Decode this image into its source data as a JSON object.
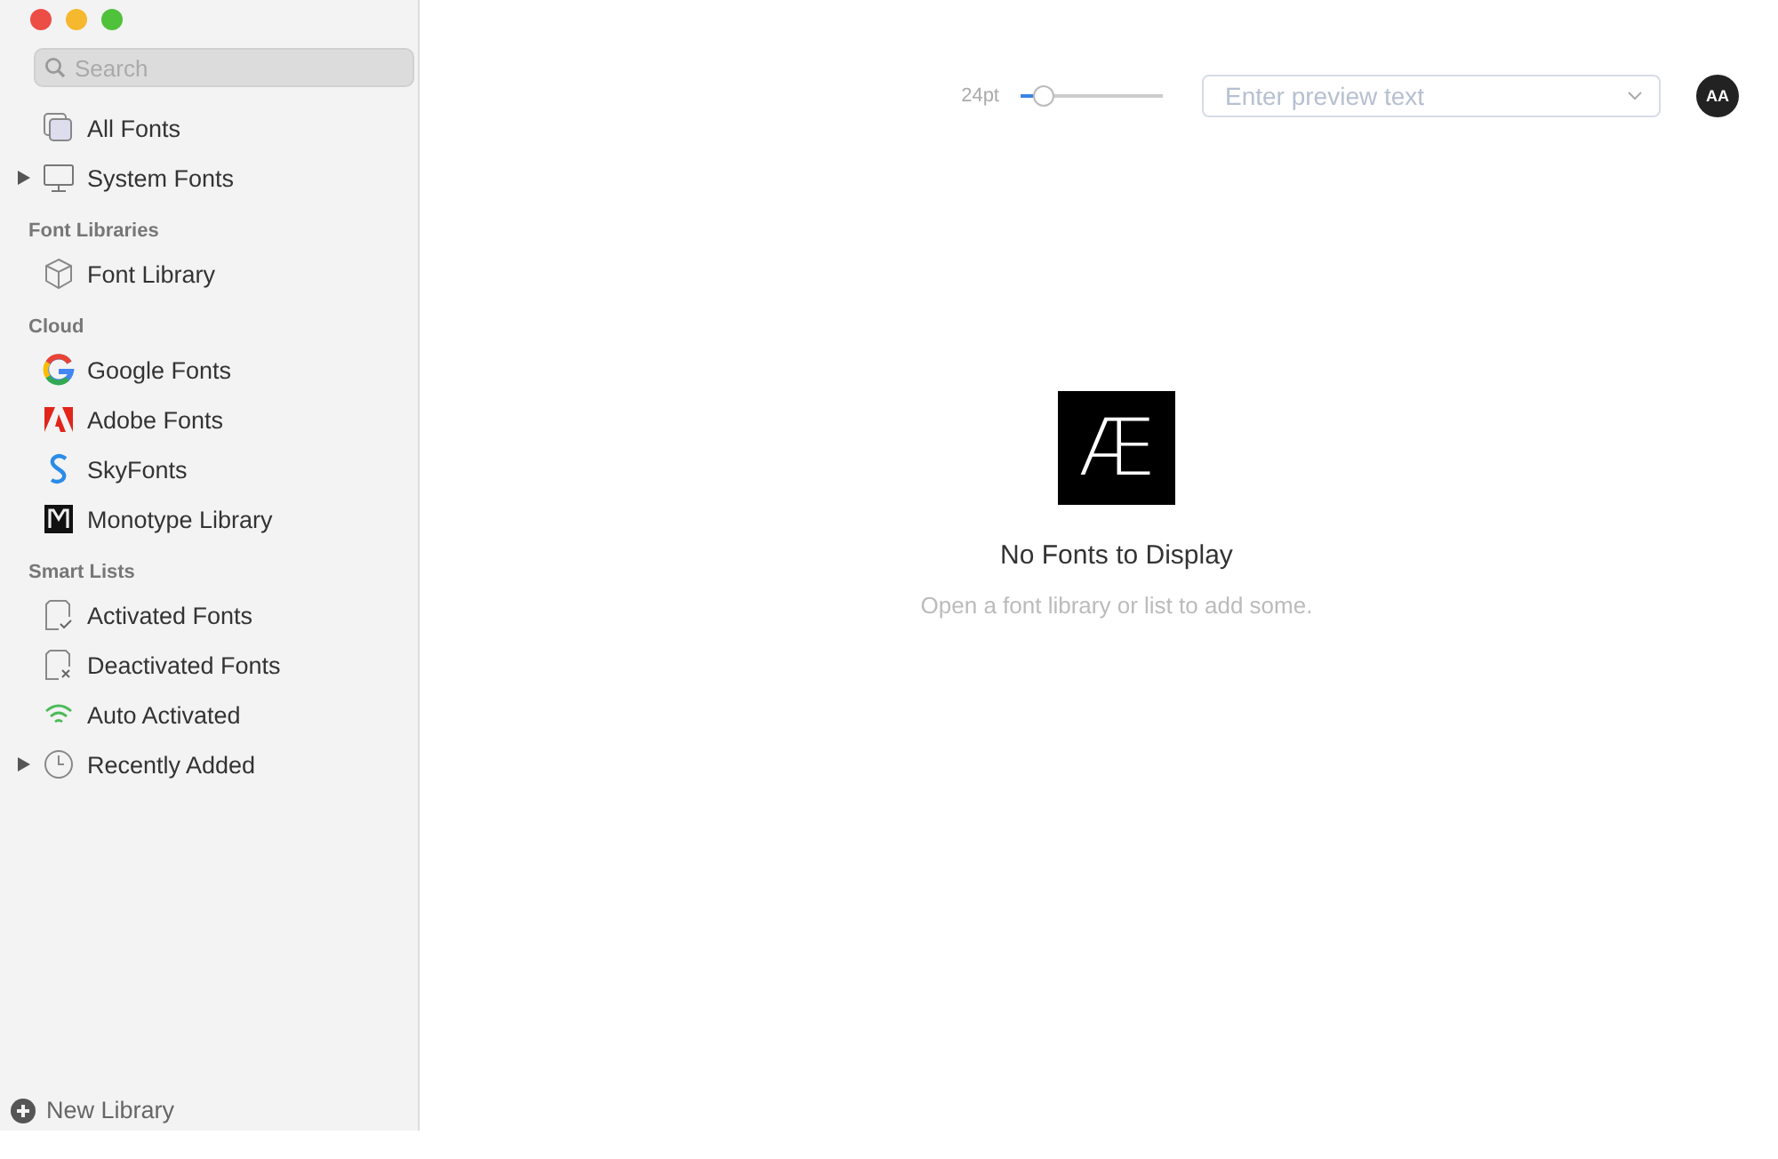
{
  "sidebar": {
    "search": {
      "placeholder": "Search"
    },
    "sections": [
      {
        "items": [
          {
            "label": "All Fonts",
            "kind": "stack"
          },
          {
            "label": "System Fonts",
            "kind": "monitor",
            "expanded": false
          }
        ]
      },
      {
        "title": "Font Libraries",
        "items": [
          {
            "label": "Font Library",
            "kind": "cube"
          }
        ]
      },
      {
        "title": "Cloud",
        "items": [
          {
            "label": "Google Fonts",
            "kind": "google"
          },
          {
            "label": "Adobe Fonts",
            "kind": "adobe"
          },
          {
            "label": "SkyFonts",
            "kind": "sky"
          },
          {
            "label": "Monotype Library",
            "kind": "monotype"
          }
        ]
      },
      {
        "title": "Smart Lists",
        "items": [
          {
            "label": "Activated Fonts",
            "kind": "activated"
          },
          {
            "label": "Deactivated Fonts",
            "kind": "deactivated"
          },
          {
            "label": "Auto Activated",
            "kind": "auto"
          },
          {
            "label": "Recently Added",
            "kind": "recent",
            "expanded": false
          }
        ]
      }
    ],
    "new_library": "New Library"
  },
  "toolbar": {
    "size": "24pt",
    "size_slider": {
      "level": 0.1
    },
    "preview": {
      "placeholder": "Enter preview text"
    },
    "font_button": "AA"
  },
  "empty_state": {
    "glyph": "Æ",
    "title": "No Fonts to Display",
    "message": "Open a font library or list to add some."
  }
}
